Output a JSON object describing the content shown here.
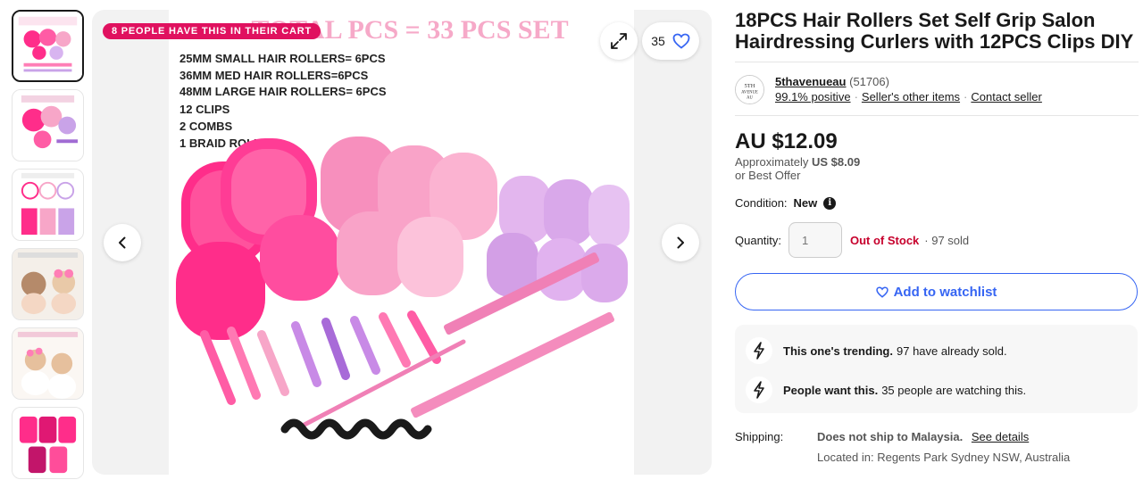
{
  "thumbnails": [
    {
      "name": "thumb-1"
    },
    {
      "name": "thumb-2"
    },
    {
      "name": "thumb-3"
    },
    {
      "name": "thumb-4"
    },
    {
      "name": "thumb-5"
    },
    {
      "name": "thumb-6"
    }
  ],
  "gallery": {
    "banner": "8 PEOPLE HAVE THIS IN THEIR CART",
    "watch_count": "35",
    "image_text": {
      "headline": "TOTAL PCS = 33 PCS SET",
      "lines": [
        "25MM SMALL HAIR ROLLERS= 6PCS",
        "36MM MED HAIR ROLLERS=6PCS",
        "48MM LARGE HAIR ROLLERS= 6PCS",
        "12 CLIPS",
        "2 COMBS",
        "1 BRAID ROLLER"
      ]
    }
  },
  "listing": {
    "title": "18PCS Hair Rollers Set Self Grip Salon Hairdressing Curlers with 12PCS Clips DIY",
    "seller": {
      "name": "5thavenueau",
      "feedback_count": "(51706)",
      "positive": "99.1% positive",
      "other_items": "Seller's other items",
      "contact": "Contact seller",
      "logo_text": "5TH AVENUE AU"
    },
    "price": "AU $12.09",
    "approx_label": "Approximately",
    "approx_value": "US $8.09",
    "best_offer": "or Best Offer",
    "condition_label": "Condition:",
    "condition_value": "New",
    "quantity_label": "Quantity:",
    "quantity_placeholder": "1",
    "stock_status": "Out of Stock",
    "sold_count": "· 97 sold",
    "watchlist_label": "Add to watchlist",
    "trending": [
      {
        "bold": "This one's trending.",
        "rest": "97 have already sold."
      },
      {
        "bold": "People want this.",
        "rest": "35 people are watching this."
      }
    ],
    "shipping": {
      "label": "Shipping:",
      "status": "Does not ship to Malaysia.",
      "details": "See details",
      "location": "Located in: Regents Park Sydney NSW, Australia"
    }
  },
  "colors": {
    "accent": "#3665f3",
    "out_of_stock": "#c7002c",
    "banner": "#e0115f",
    "hot_pink": "#ff2d8a",
    "light_pink": "#f7a6c8",
    "lavender": "#c9a3e8"
  }
}
